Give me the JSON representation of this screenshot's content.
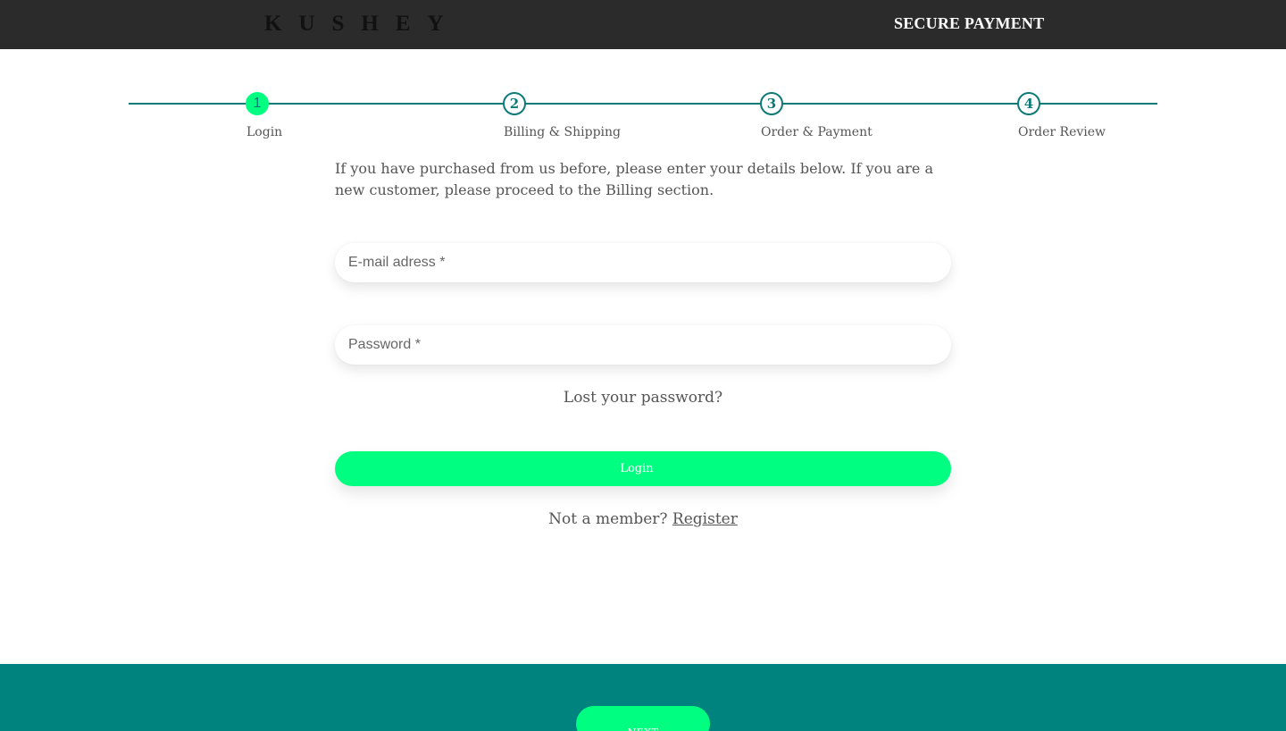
{
  "header": {
    "logo": "KUSHEY",
    "secure_label": "SECURE PAYMENT"
  },
  "steps": [
    {
      "number": "1",
      "label": "Login",
      "active": true
    },
    {
      "number": "2",
      "label": "Billing & Shipping",
      "active": false
    },
    {
      "number": "3",
      "label": "Order & Payment",
      "active": false
    },
    {
      "number": "4",
      "label": "Order Review",
      "active": false
    }
  ],
  "login": {
    "intro": "If you have purchased from us before, please enter your details below. If you are a new customer, please proceed to the Billing section.",
    "email_placeholder": "E-mail adress *",
    "password_placeholder": "Password *",
    "lost_password": "Lost your password?",
    "login_button": "Login",
    "not_member": "Not a member?",
    "register_link": "Register"
  },
  "footer": {
    "next_button": "NEXT"
  },
  "colors": {
    "header_bg": "#2b2b2b",
    "accent_green": "#00ff80",
    "teal": "#00827f"
  }
}
